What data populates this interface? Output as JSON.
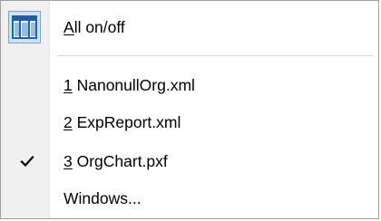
{
  "menu": {
    "items": [
      {
        "accel": "A",
        "rest": "ll on/off",
        "icon": "window-layout-icon",
        "checked": false
      },
      {
        "accel": "1",
        "rest": " NanonullOrg.xml",
        "checked": false
      },
      {
        "accel": "2",
        "rest": " ExpReport.xml",
        "checked": false
      },
      {
        "accel": "3",
        "rest": " OrgChart.pxf",
        "checked": true
      },
      {
        "text": "Windows...",
        "checked": false
      }
    ]
  },
  "colors": {
    "gutter": "#f0f0f0",
    "icon_highlight": "#cce4f7",
    "icon_border": "#7da2ce",
    "icon_blue": "#1f5fb0",
    "separator": "#d7d7d7",
    "text": "#000000"
  }
}
